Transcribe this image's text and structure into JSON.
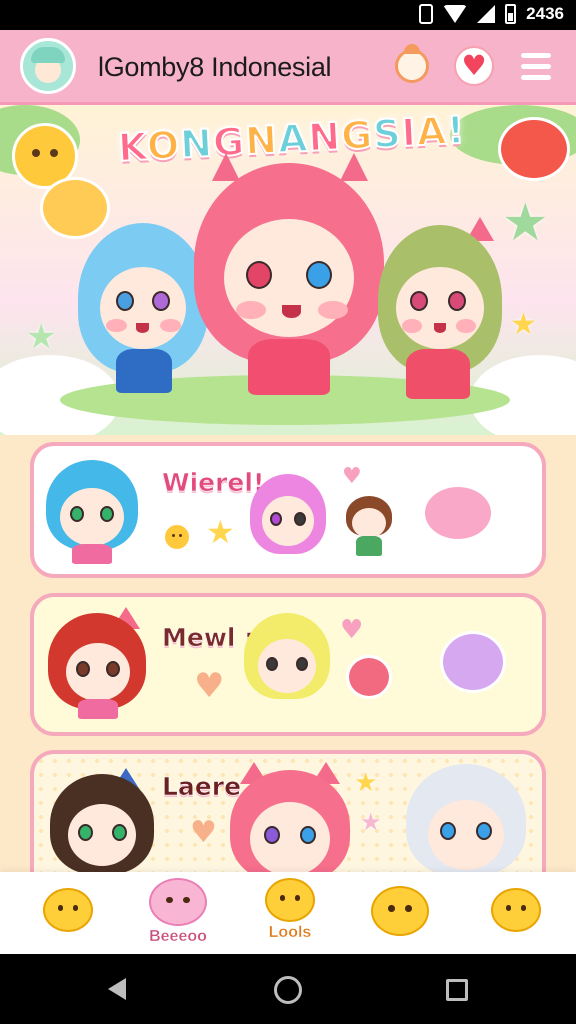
{
  "status_bar": {
    "time": "2436"
  },
  "header": {
    "app_title": "lGomby8 Indonesial",
    "icons": [
      "avatar-icon",
      "profile-icon",
      "heart-icon",
      "menu-icon"
    ]
  },
  "hero": {
    "banner_title": "KONGNANGSIA!"
  },
  "cards": [
    {
      "title": "Wierel!"
    },
    {
      "title": "Mewl :"
    },
    {
      "title": "Laere"
    }
  ],
  "bottom_nav": {
    "items": [
      {
        "icon": "chick-icon",
        "label": ""
      },
      {
        "icon": "bear-icon",
        "label": "Beeeoo"
      },
      {
        "icon": "chick-icon",
        "label": "Lools"
      },
      {
        "icon": "chick-icon",
        "label": ""
      },
      {
        "icon": "chick-icon",
        "label": ""
      }
    ]
  },
  "colors": {
    "header_bg": "#f7b3c9",
    "accent_pink": "#f5a9bd",
    "card_cream": "#fffbd9"
  }
}
